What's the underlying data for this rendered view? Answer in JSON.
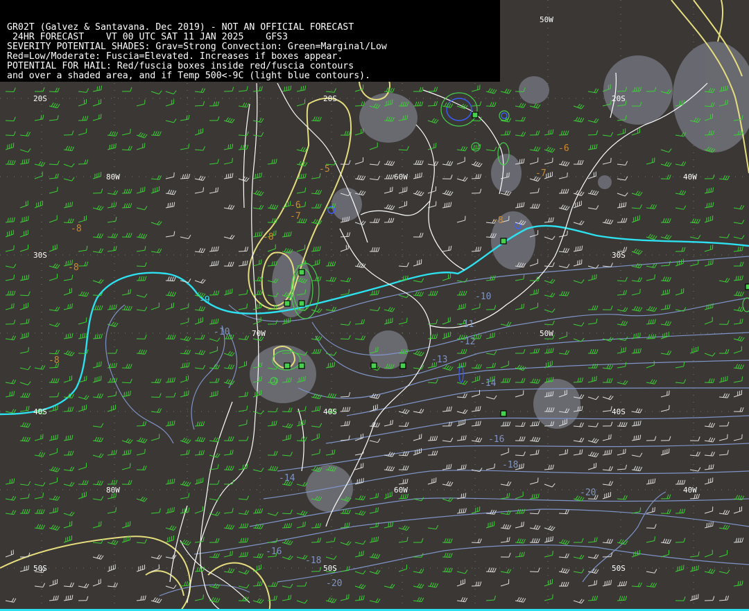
{
  "header": {
    "line1": "GR02T (Galvez & Santavana. Dec 2019) - NOT AN OFFICIAL FORECAST",
    "line2": " 24HR FORECAST    VT 00 UTC SAT 11 JAN 2025    GFS3",
    "line3": "SEVERITY POTENTIAL SHADES: Grav=Strong Convection: Green=Marginal/Low",
    "line4": "Red=Low/Moderate: Fuscia=Elevated. Increases if boxes appear.",
    "line5": "POTENTIAL FOR HAIL: Red/fuscia boxes inside red/fuscia contours",
    "line6": "and over a shaded area, and if Temp 500<-9C (light blue contours)."
  },
  "grid_labels": {
    "lat_20s": "20S",
    "lat_30s": "30S",
    "lat_40s": "40S",
    "lat_50s": "50S",
    "lon_80w": "80W",
    "lon_70w": "70W",
    "lon_60w": "60W",
    "lon_50w": "50W",
    "lon_40w": "40W"
  },
  "colors": {
    "background": "#3a3734",
    "coastline": "#ffffff",
    "temp_500_contour": "#7f94c8",
    "temp_minus9_contour": "#2de1f0",
    "temp_warm_label": "#d08a2c",
    "jet_contour": "#e6dd7e",
    "convection_shade": "#6b6b74",
    "marginal_green": "#47d04d",
    "wind_barb_green": "#3cd236",
    "wind_barb_white": "#e0e0e0"
  },
  "temperature_labels": [
    "-5",
    "-6",
    "-7",
    "-8",
    "-8",
    "-8",
    "-8",
    "-8",
    "-9",
    "-10",
    "-10",
    "-11",
    "-12",
    "-13",
    "-14",
    "-14",
    "-16",
    "-16",
    "-18",
    "-18",
    "-20",
    "-20"
  ],
  "hail_boxes_count": 11
}
